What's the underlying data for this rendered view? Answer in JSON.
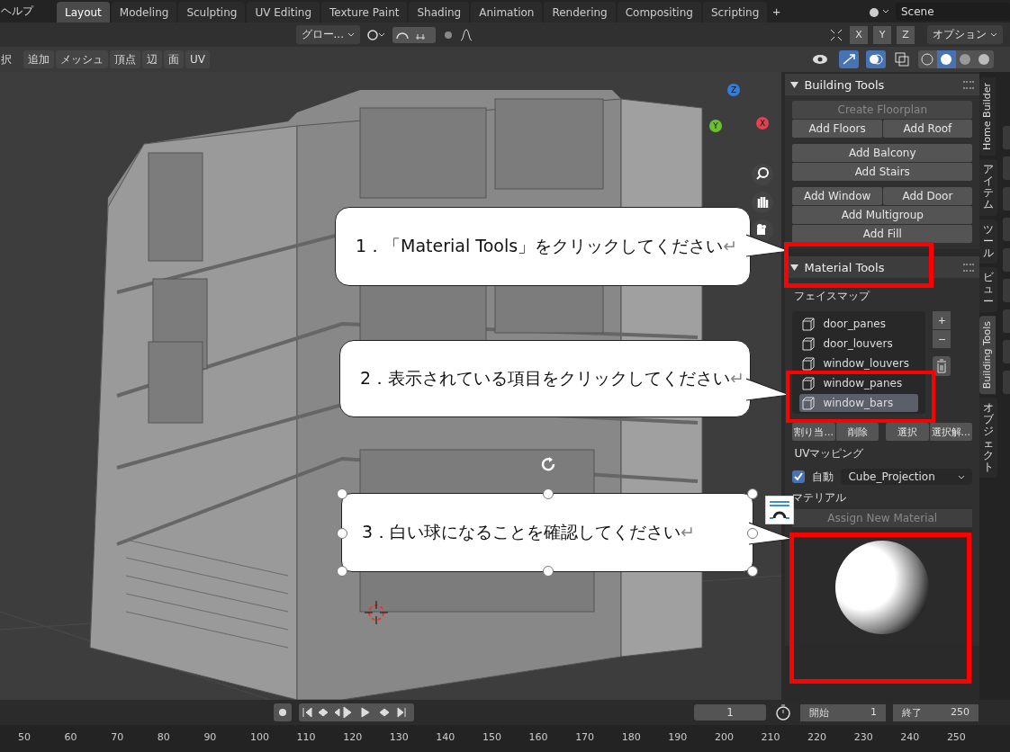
{
  "topbar": {
    "menu_cut": "ヘルプ",
    "workspaces": [
      {
        "label": "Layout",
        "selected": true
      },
      {
        "label": "Modeling",
        "selected": false
      },
      {
        "label": "Sculpting",
        "selected": false
      },
      {
        "label": "UV Editing",
        "selected": false
      },
      {
        "label": "Texture Paint",
        "selected": false
      },
      {
        "label": "Shading",
        "selected": false
      },
      {
        "label": "Animation",
        "selected": false
      },
      {
        "label": "Rendering",
        "selected": false
      },
      {
        "label": "Compositing",
        "selected": false
      },
      {
        "label": "Scripting",
        "selected": false
      }
    ],
    "add_tab": "+",
    "scene": "Scene"
  },
  "tool_header": {
    "orientation": "グロー...",
    "axes": [
      {
        "label": "X"
      },
      {
        "label": "Y"
      },
      {
        "label": "Z"
      }
    ],
    "options": "オプション"
  },
  "viewport_header": {
    "menus": [
      "択",
      "追加",
      "メッシュ",
      "頂点",
      "辺",
      "面",
      "UV"
    ]
  },
  "gizmo": {
    "axes": [
      "Z",
      "Y",
      "X"
    ]
  },
  "callouts": [
    {
      "number": "1．",
      "text": "「Material Tools」をクリックしてください",
      "mark": "↵",
      "selected": false
    },
    {
      "number": "2．",
      "text": "表示されている項目をクリックしてください",
      "mark": "↵",
      "selected": false
    },
    {
      "number": "3．",
      "text": "白い球になることを確認してください",
      "mark": "↵",
      "selected": true
    }
  ],
  "sidebar": {
    "building_tools": {
      "title": "Building Tools",
      "expanded": true,
      "groups": [
        [
          {
            "label": "Create Floorplan",
            "disabled": true
          }
        ],
        [
          {
            "label": "Add Floors",
            "disabled": false
          },
          {
            "label": "Add Roof",
            "disabled": false
          }
        ]
      ],
      "groups2": [
        [
          {
            "label": "Add Balcony",
            "disabled": false
          }
        ],
        [
          {
            "label": "Add Stairs",
            "disabled": false
          }
        ]
      ],
      "groups3": [
        [
          {
            "label": "Add Window",
            "disabled": false
          },
          {
            "label": "Add Door",
            "disabled": false
          }
        ],
        [
          {
            "label": "Add Multigroup",
            "disabled": false
          }
        ],
        [
          {
            "label": "Add Fill",
            "disabled": false
          }
        ]
      ]
    },
    "material_tools": {
      "title": "Material Tools",
      "expanded": true,
      "facemap_label": "フェイスマップ",
      "facemaps": [
        {
          "name": "door_panes",
          "selected": false
        },
        {
          "name": "door_louvers",
          "selected": false
        },
        {
          "name": "window_louvers",
          "selected": false
        },
        {
          "name": "window_panes",
          "selected": false
        },
        {
          "name": "window_bars",
          "selected": true
        }
      ],
      "list_buttons": [
        "+",
        "−"
      ],
      "buttons_left": [
        "割り当...",
        "削除"
      ],
      "buttons_right": [
        "選択",
        "選択解..."
      ],
      "uv_label": "UVマッピング",
      "auto": {
        "label": "自動",
        "checked": true
      },
      "projection": "Cube_Projection",
      "material_label": "マテリアル",
      "assign_button": "Assign New Material"
    }
  },
  "side_tabs": [
    {
      "label": "Home Builder",
      "selected": false,
      "kind": "latin"
    },
    {
      "label": "アイテム",
      "selected": false,
      "kind": "cjk"
    },
    {
      "label": "ツール",
      "selected": false,
      "kind": "cjk"
    },
    {
      "label": "ビュー",
      "selected": false,
      "kind": "cjk"
    },
    {
      "label": "Building Tools",
      "selected": true,
      "kind": "latin"
    },
    {
      "label": "オブジェクト",
      "selected": false,
      "kind": "cjk"
    }
  ],
  "timeline": {
    "current_frame": "1",
    "start_label": "開始",
    "start": "1",
    "end_label": "終了",
    "end": "250",
    "ruler": [
      "50",
      "60",
      "70",
      "80",
      "90",
      "100",
      "110",
      "120",
      "130",
      "140",
      "150",
      "160",
      "170",
      "180",
      "190",
      "200",
      "210",
      "220",
      "230",
      "240",
      "250"
    ]
  }
}
